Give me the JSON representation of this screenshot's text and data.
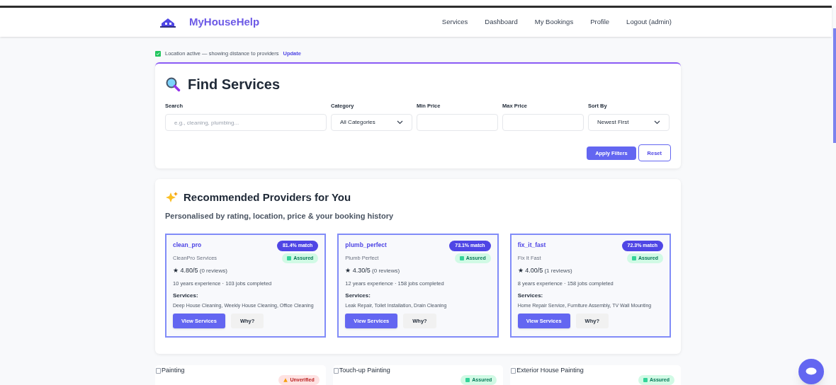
{
  "nav": {
    "brand": "MyHouseHelp",
    "links": [
      "Services",
      "Dashboard",
      "My Bookings",
      "Profile",
      "Logout (admin)"
    ]
  },
  "location": {
    "active": true,
    "text": "Location active — showing distance to providers",
    "action": "Update"
  },
  "filters": {
    "title": "Find Services",
    "fields": [
      {
        "kind": "text",
        "label": "Search",
        "placeholder": "e.g., cleaning, plumbing..."
      },
      {
        "kind": "select",
        "label": "Category",
        "value": "All Categories"
      },
      {
        "kind": "text",
        "label": "Min Price"
      },
      {
        "kind": "text",
        "label": "Max Price"
      },
      {
        "kind": "select",
        "label": "Sort By",
        "value": "Newest First"
      }
    ],
    "apply": "Apply Filters",
    "reset": "Reset"
  },
  "recommended": {
    "title": "Recommended Providers for You",
    "subtitle": "Personalised by rating, location, price & your booking history",
    "providers": [
      {
        "username": "clean_pro",
        "name": "CleanPro Services",
        "match": "81.4% match",
        "verified": true,
        "badge": "Assured",
        "rating": "★ 4.80/5",
        "reviews": "(0 reviews)",
        "stats": "10 years experience · 103 jobs completed",
        "services_label": "Services:",
        "services": "Deep House Cleaning, Weekly House Cleaning, Office Cleaning",
        "view": "View Services",
        "why": "Why?"
      },
      {
        "username": "plumb_perfect",
        "name": "Plumb Perfect",
        "match": "73.1% match",
        "verified": true,
        "badge": "Assured",
        "rating": "★ 4.30/5",
        "reviews": "(0 reviews)",
        "stats": "12 years experience · 158 jobs completed",
        "services_label": "Services:",
        "services": "Leak Repair, Toilet Installation, Drain Cleaning",
        "view": "View Services",
        "why": "Why?"
      },
      {
        "username": "fix_it_fast",
        "name": "Fix It Fast",
        "match": "72.3% match",
        "verified": true,
        "badge": "Assured",
        "rating": "★ 4.00/5",
        "reviews": "(1 reviews)",
        "stats": "8 years experience · 158 jobs completed",
        "services_label": "Services:",
        "services": "Home Repair Service, Furniture Assembly, TV Wall Mounting",
        "view": "View Services",
        "why": "Why?"
      }
    ]
  },
  "services": [
    {
      "image_alt": "Painting",
      "verified": false,
      "badge": "Unverified"
    },
    {
      "image_alt": "Touch-up Painting",
      "verified": true,
      "badge": "Assured"
    },
    {
      "image_alt": "Exterior House Painting",
      "verified": true,
      "badge": "Assured"
    }
  ]
}
